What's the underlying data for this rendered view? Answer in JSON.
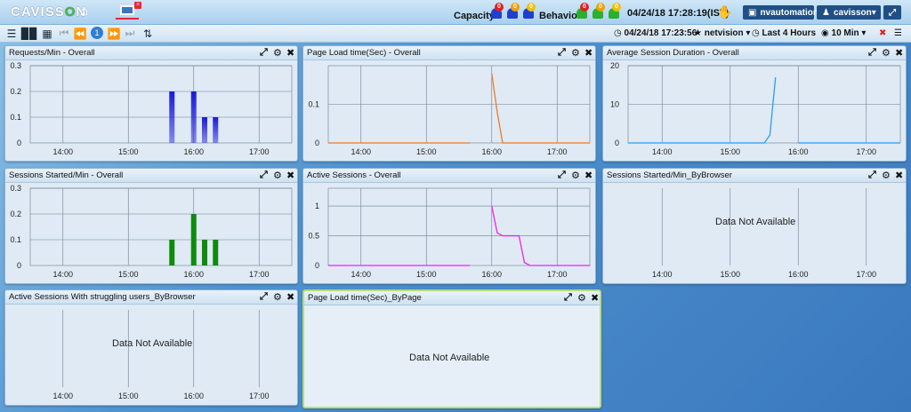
{
  "app": {
    "logo_pre": "CAVISS",
    "logo_o": "O",
    "logo_post": "N"
  },
  "alerts": {
    "capacity_label": "Capacity",
    "behavior_label": "Behavior",
    "capacity_bells": [
      {
        "count": "0",
        "color": "#e02020"
      },
      {
        "count": "0",
        "color": "#f0a000"
      },
      {
        "count": "0",
        "color": "#f0c000"
      }
    ],
    "behavior_bells": [
      {
        "count": "0",
        "color": "#e02020"
      },
      {
        "count": "0",
        "color": "#f0a000"
      },
      {
        "count": "0",
        "color": "#f0c000"
      }
    ]
  },
  "header": {
    "system_time": "04/24/18 17:28:19(IST)",
    "user_button": "nvautomation",
    "account": "cavisson"
  },
  "toolbar": {
    "page_number": "1",
    "time_readout": "04/24/18 17:23:56",
    "favorite": "netvision",
    "duration": "Last 4 Hours",
    "interval": "10 Min"
  },
  "colors": {
    "accent": "#1f4f86",
    "bar_blue": "#1a1ad8",
    "bar_green": "#0f8a0f",
    "orange": "#f07a20",
    "sky": "#2a9df0",
    "magenta": "#f020f0"
  },
  "panels": [
    {
      "title": "Requests/Min - Overall"
    },
    {
      "title": "Page Load time(Sec) - Overall"
    },
    {
      "title": "Average Session Duration - Overall"
    },
    {
      "title": "Sessions Started/Min - Overall"
    },
    {
      "title": "Active Sessions - Overall"
    },
    {
      "title": "Sessions Started/Min_ByBrowser",
      "message": "Data Not Available"
    },
    {
      "title": "Active Sessions With struggling users_ByBrowser",
      "message": "Data Not Available"
    },
    {
      "title": "Page Load time(Sec)_ByPage",
      "message": "Data Not Available"
    }
  ],
  "chart_data": [
    {
      "type": "bar",
      "title": "Requests/Min - Overall",
      "x_ticks": [
        "14:00",
        "15:00",
        "16:00",
        "17:00"
      ],
      "y_ticks": [
        "0",
        "0.1",
        "0.2",
        "0.3"
      ],
      "ylim": [
        0,
        0.3
      ],
      "series": [
        {
          "color": "#1a1ad8",
          "x": [
            "15:40",
            "16:00",
            "16:10",
            "16:20"
          ],
          "values": [
            0.2,
            0.2,
            0.1,
            0.1
          ]
        }
      ]
    },
    {
      "type": "line",
      "title": "Page Load time(Sec) - Overall",
      "x_ticks": [
        "14:00",
        "15:00",
        "16:00",
        "17:00"
      ],
      "y_ticks": [
        "0",
        "0.1"
      ],
      "ylim": [
        0,
        0.2
      ],
      "series": [
        {
          "color": "#f07a20",
          "segments": [
            [
              [
                "13:30",
                0
              ],
              [
                "15:40",
                0
              ]
            ],
            [
              [
                "16:00",
                0.18
              ],
              [
                "16:05",
                0.08
              ],
              [
                "16:10",
                0
              ],
              [
                "17:30",
                0
              ]
            ]
          ]
        }
      ]
    },
    {
      "type": "line",
      "title": "Average Session Duration - Overall",
      "x_ticks": [
        "14:00",
        "15:00",
        "16:00",
        "17:00"
      ],
      "y_ticks": [
        "0",
        "10",
        "20"
      ],
      "ylim": [
        0,
        20
      ],
      "series": [
        {
          "color": "#2a9df0",
          "segments": [
            [
              [
                "13:30",
                0
              ],
              [
                "15:30",
                0
              ],
              [
                "15:35",
                2
              ],
              [
                "15:40",
                17
              ]
            ],
            [
              [
                "16:00",
                0
              ],
              [
                "17:30",
                0
              ]
            ]
          ]
        }
      ]
    },
    {
      "type": "bar",
      "title": "Sessions Started/Min - Overall",
      "x_ticks": [
        "14:00",
        "15:00",
        "16:00",
        "17:00"
      ],
      "y_ticks": [
        "0",
        "0.1",
        "0.2",
        "0.3"
      ],
      "ylim": [
        0,
        0.3
      ],
      "series": [
        {
          "color": "#0f8a0f",
          "x": [
            "15:40",
            "16:00",
            "16:10",
            "16:20"
          ],
          "values": [
            0.1,
            0.2,
            0.1,
            0.1
          ]
        }
      ]
    },
    {
      "type": "line",
      "title": "Active Sessions - Overall",
      "x_ticks": [
        "14:00",
        "15:00",
        "16:00",
        "17:00"
      ],
      "y_ticks": [
        "0",
        "0.5",
        "1"
      ],
      "ylim": [
        0,
        1.3
      ],
      "series": [
        {
          "color": "#f020f0",
          "segments": [
            [
              [
                "13:30",
                0
              ],
              [
                "15:40",
                0
              ]
            ],
            [
              [
                "16:00",
                1
              ],
              [
                "16:05",
                0.55
              ],
              [
                "16:10",
                0.5
              ],
              [
                "16:25",
                0.5
              ],
              [
                "16:30",
                0.05
              ],
              [
                "16:35",
                0
              ],
              [
                "17:30",
                0
              ]
            ]
          ]
        }
      ]
    },
    {
      "type": "line",
      "title": "Sessions Started/Min_ByBrowser",
      "x_ticks": [
        "14:00",
        "15:00",
        "16:00",
        "17:00"
      ],
      "series": []
    },
    {
      "type": "line",
      "title": "Active Sessions With struggling users_ByBrowser",
      "x_ticks": [
        "14:00",
        "15:00",
        "16:00",
        "17:00"
      ],
      "series": []
    }
  ]
}
